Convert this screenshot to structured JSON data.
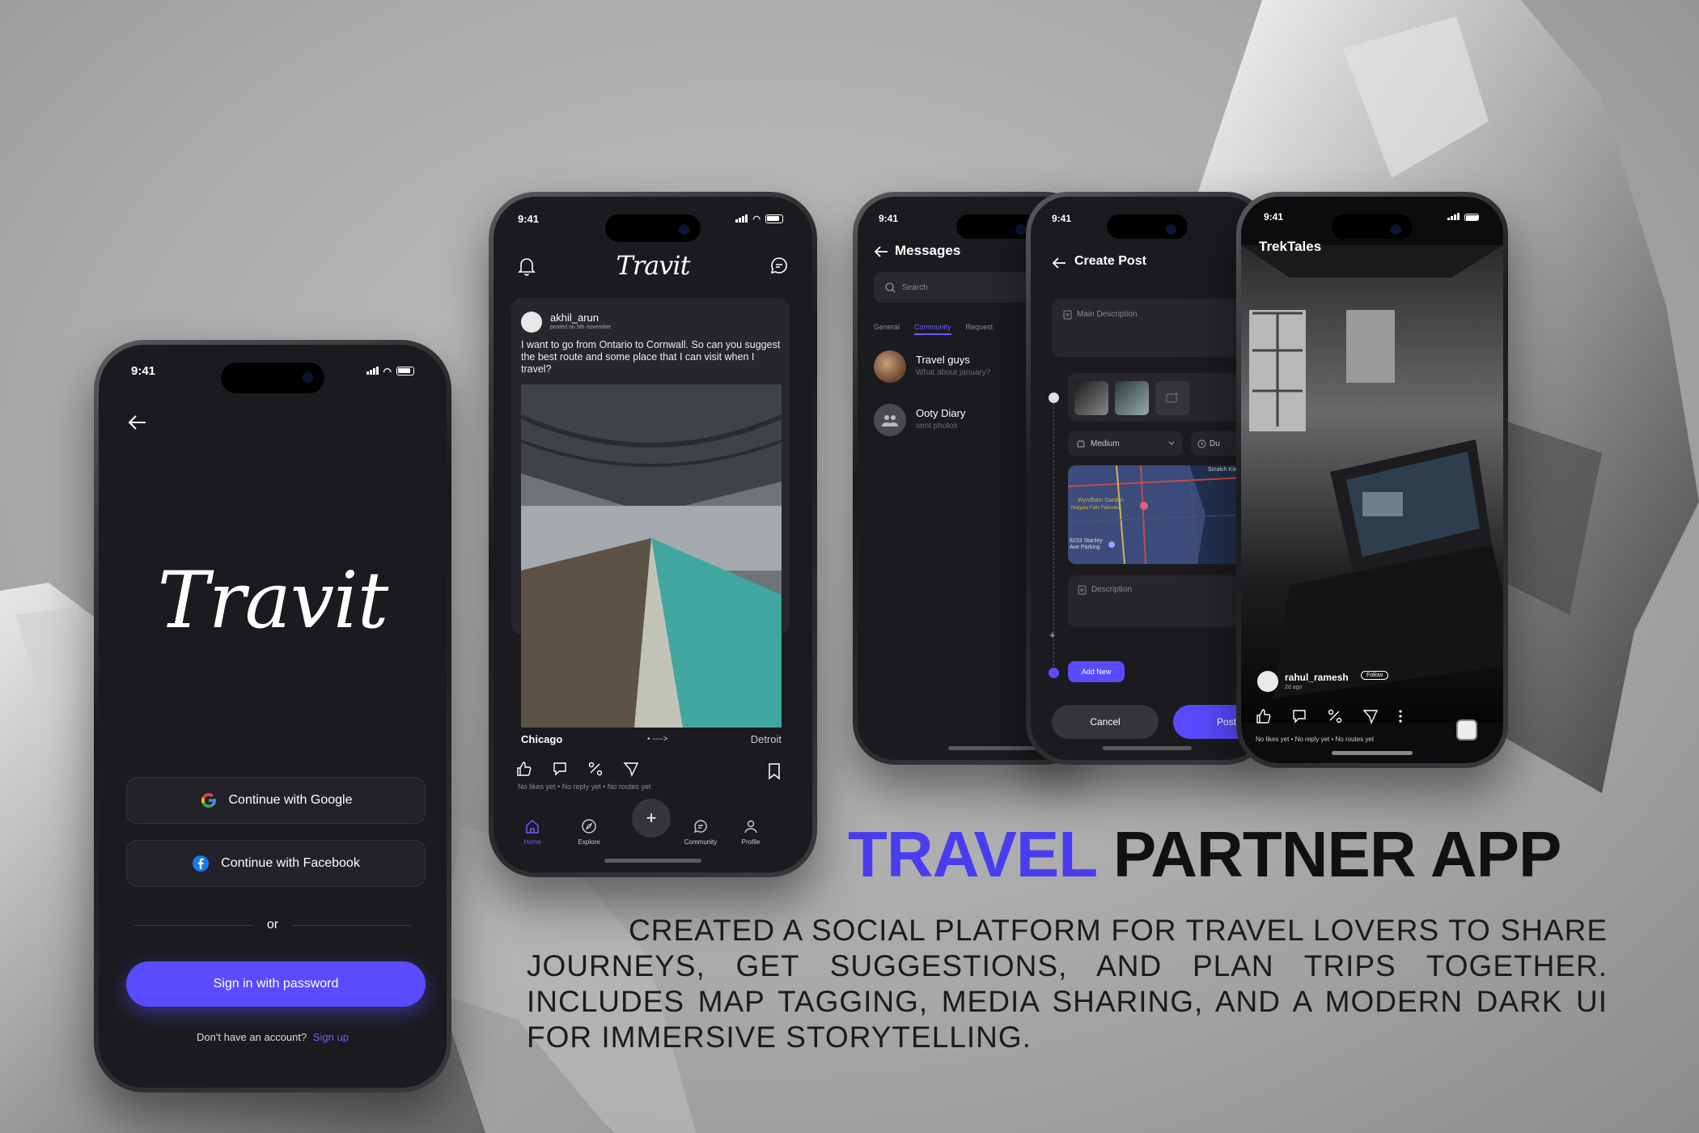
{
  "status_time": "9:41",
  "login": {
    "logo": "Travit",
    "google_btn": "Continue with Google",
    "facebook_btn": "Continue with Facebook",
    "divider": "or",
    "password_btn": "Sign in with password",
    "no_account": "Don't have an account?",
    "signup": "Sign up"
  },
  "feed": {
    "logo": "Travit",
    "post": {
      "username": "akhil_arun",
      "date": "posted on 5th november",
      "text": "I want to go from Ontario to Cornwall. So can you suggest the best route and some place that I can visit when I travel?",
      "from": "Chicago",
      "to": "Detroit",
      "route_arrow": "•  ---->",
      "stats": "No likes yet • No reply yet • No routes yet"
    },
    "nav": [
      {
        "label": "Home"
      },
      {
        "label": "Explore"
      },
      {
        "label": "Community"
      },
      {
        "label": "Profile"
      }
    ],
    "add_symbol": "+"
  },
  "messages": {
    "title": "Messages",
    "search_placeholder": "Search",
    "tabs": [
      "General",
      "Community",
      "Request"
    ],
    "items": [
      {
        "name": "Travel guys",
        "preview": "What about january?"
      },
      {
        "name": "Ooty Diary",
        "preview": "sent photos"
      }
    ]
  },
  "create_post": {
    "title": "Create Post",
    "main_description": "Main Description",
    "difficulty": "Medium",
    "duration_partial": "Du",
    "map_labels": [
      "Scratch Kitchen",
      "Wyndham Garden",
      "Niagara Falls Fallsview",
      "6233 Stanley Ave Parking"
    ],
    "description": "Description",
    "add_new": "Add New",
    "cancel": "Cancel",
    "post": "Post"
  },
  "reel": {
    "title": "TrekTales",
    "username": "rahul_ramesh",
    "follow": "Follow",
    "time": "2d ago",
    "stats": "No likes yet • No reply yet • No routes yet"
  },
  "headline": {
    "accent": "TRAVEL",
    "rest": "PARTNER APP",
    "accent_color": "#4a3df0"
  },
  "description": "CREATED A SOCIAL PLATFORM FOR TRAVEL LOVERS TO SHARE JOURNEYS, GET SUGGESTIONS, AND PLAN TRIPS TOGETHER. INCLUDES MAP TAGGING, MEDIA SHARING, AND A MODERN DARK UI FOR IMMERSIVE STORYTELLING.",
  "colors": {
    "primary": "#5b4bff",
    "screen_bg": "#1b1b1f"
  }
}
